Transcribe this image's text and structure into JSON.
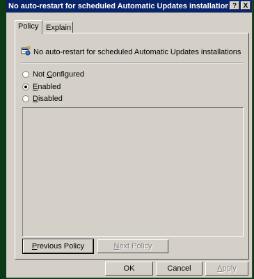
{
  "window": {
    "title": "No auto-restart for scheduled Automatic Updates installation...",
    "help_label": "?",
    "close_label": "X"
  },
  "tabs": [
    {
      "label": "Policy",
      "active": true
    },
    {
      "label": "Explain",
      "active": false
    }
  ],
  "policy": {
    "name": "No auto-restart for scheduled Automatic Updates installations",
    "icon": "policy-setting-icon"
  },
  "options": {
    "not_configured": {
      "prefix": "Not ",
      "underline": "C",
      "rest": "onfigured",
      "selected": false
    },
    "enabled": {
      "underline": "E",
      "rest": "nabled",
      "selected": true
    },
    "disabled": {
      "underline": "D",
      "rest": "isabled",
      "selected": false
    }
  },
  "nav": {
    "previous": {
      "underline": "P",
      "rest": "revious Policy"
    },
    "next": {
      "underline": "N",
      "rest": "ext Policy"
    }
  },
  "dialog_buttons": {
    "ok": "OK",
    "cancel": "Cancel",
    "apply": {
      "underline": "A",
      "rest": "pply"
    }
  }
}
